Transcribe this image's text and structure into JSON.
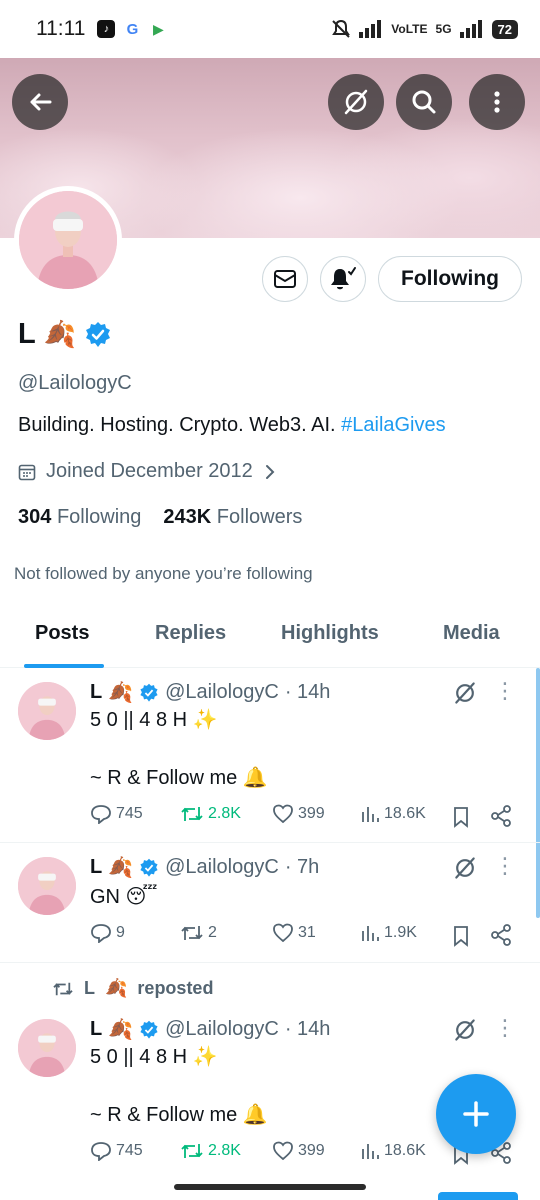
{
  "status_bar": {
    "time": "11:11",
    "battery": "72",
    "network": "5G"
  },
  "profile": {
    "name": "L",
    "name_emoji": "🍂",
    "handle": "@LailologyC",
    "bio_text": "Building. Hosting. Crypto. Web3. AI. ",
    "bio_tag": "#LailaGives",
    "joined": "Joined December 2012",
    "following_count": "304",
    "following_label": "Following",
    "followers_count": "243K",
    "followers_label": "Followers",
    "not_followed": "Not followed by anyone you’re following",
    "follow_button": "Following"
  },
  "tabs": [
    {
      "label": "Posts"
    },
    {
      "label": "Replies"
    },
    {
      "label": "Highlights"
    },
    {
      "label": "Media"
    }
  ],
  "repost_label": "reposted",
  "posts": [
    {
      "name": "L",
      "emoji": "🍂",
      "handle": "@LailologyC",
      "time": "· 14h",
      "text": "5 0 || 4 8 H ✨\n\n~ R & Follow me 🔔",
      "replies": "745",
      "reposts": "2.8K",
      "likes": "399",
      "views": "18.6K"
    },
    {
      "name": "L",
      "emoji": "🍂",
      "handle": "@LailologyC",
      "time": "· 7h",
      "text": "GN 😴",
      "replies": "9",
      "reposts": "2",
      "likes": "31",
      "views": "1.9K"
    },
    {
      "name": "L",
      "emoji": "🍂",
      "handle": "@LailologyC",
      "time": "· 14h",
      "text": "5 0 || 4 8 H ✨\n\n~ R & Follow me 🔔",
      "replies": "745",
      "reposts": "2.8K",
      "likes": "399",
      "views": "18.6K"
    }
  ],
  "colors": {
    "accent": "#1d9bf0",
    "repost_green": "#00ba7c",
    "banner": "#e2c2cc"
  }
}
